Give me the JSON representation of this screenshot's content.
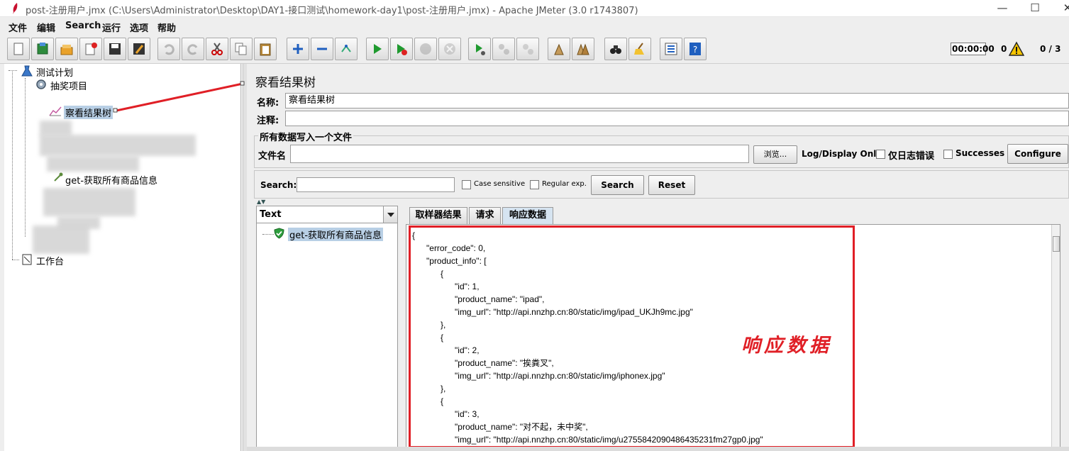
{
  "window": {
    "title": "post-注册用户.jmx (C:\\Users\\Administrator\\Desktop\\DAY1-接口测试\\homework-day1\\post-注册用户.jmx) - Apache JMeter (3.0 r1743807)",
    "minimize": "—",
    "maximize": "☐"
  },
  "menu": [
    "文件",
    "编辑",
    "Search",
    "运行",
    "选项",
    "帮助"
  ],
  "toolbar": {
    "buttons": [
      "new-icon",
      "templates-icon",
      "open-icon",
      "close-icon",
      "save-icon",
      "save-as-icon",
      "undo-icon",
      "redo-icon",
      "cut-icon",
      "copy-icon",
      "paste-icon",
      "expand-icon",
      "collapse-icon",
      "toggle-icon",
      "start-icon",
      "start-no-pause-icon",
      "stop-icon",
      "shutdown-icon",
      "remote-start-icon",
      "remote-stop-icon",
      "remote-shutdown-icon",
      "clear-icon",
      "clear-all-icon",
      "search-icon",
      "reset-search-icon",
      "function-helper-icon",
      "help-icon"
    ],
    "timer": "00:00:00",
    "warnings": "0",
    "threads": "0 / 3"
  },
  "tree": {
    "test_plan": "测试计划",
    "thread_group": "抽奖项目",
    "listener": "察看结果树",
    "sampler": "get-获取所有商品信息",
    "workbench": "工作台"
  },
  "panel": {
    "title": "察看结果树",
    "name_label": "名称:",
    "name_value": "察看结果树",
    "comment_label": "注释:",
    "comment_value": "",
    "file_group_label": "所有数据写入一个文件",
    "filename_label": "文件名",
    "filename_value": "",
    "browse_label": "浏览...",
    "log_display_label": "Log/Display Only:",
    "errors_only_label": "仅日志错误",
    "successes_label": "Successes",
    "configure_label": "Configure"
  },
  "search": {
    "label": "Search:",
    "value": "",
    "case_sensitive": "Case sensitive",
    "regular_exp": "Regular exp.",
    "search_button": "Search",
    "reset_button": "Reset"
  },
  "results": {
    "renderer": "Text",
    "items": [
      "get-获取所有商品信息"
    ],
    "tabs": [
      "取样器结果",
      "请求",
      "响应数据"
    ],
    "active_tab": "响应数据",
    "response_text": "{\n      \"error_code\": 0,\n      \"product_info\": [\n            {\n                  \"id\": 1,\n                  \"product_name\": \"ipad\",\n                  \"img_url\": \"http://api.nnzhp.cn:80/static/img/ipad_UKJh9mc.jpg\"\n            },\n            {\n                  \"id\": 2,\n                  \"product_name\": \"挨粪叉\",\n                  \"img_url\": \"http://api.nnzhp.cn:80/static/img/iphonex.jpg\"\n            },\n            {\n                  \"id\": 3,\n                  \"product_name\": \"对不起，未中奖\",\n                  \"img_url\": \"http://api.nnzhp.cn:80/static/img/u2755842090486435231fm27gp0.jpg\"",
    "annotation": "响应数据"
  },
  "colors": {
    "annotation_red": "#e01f26",
    "selection_blue": "#b8cfe5"
  }
}
